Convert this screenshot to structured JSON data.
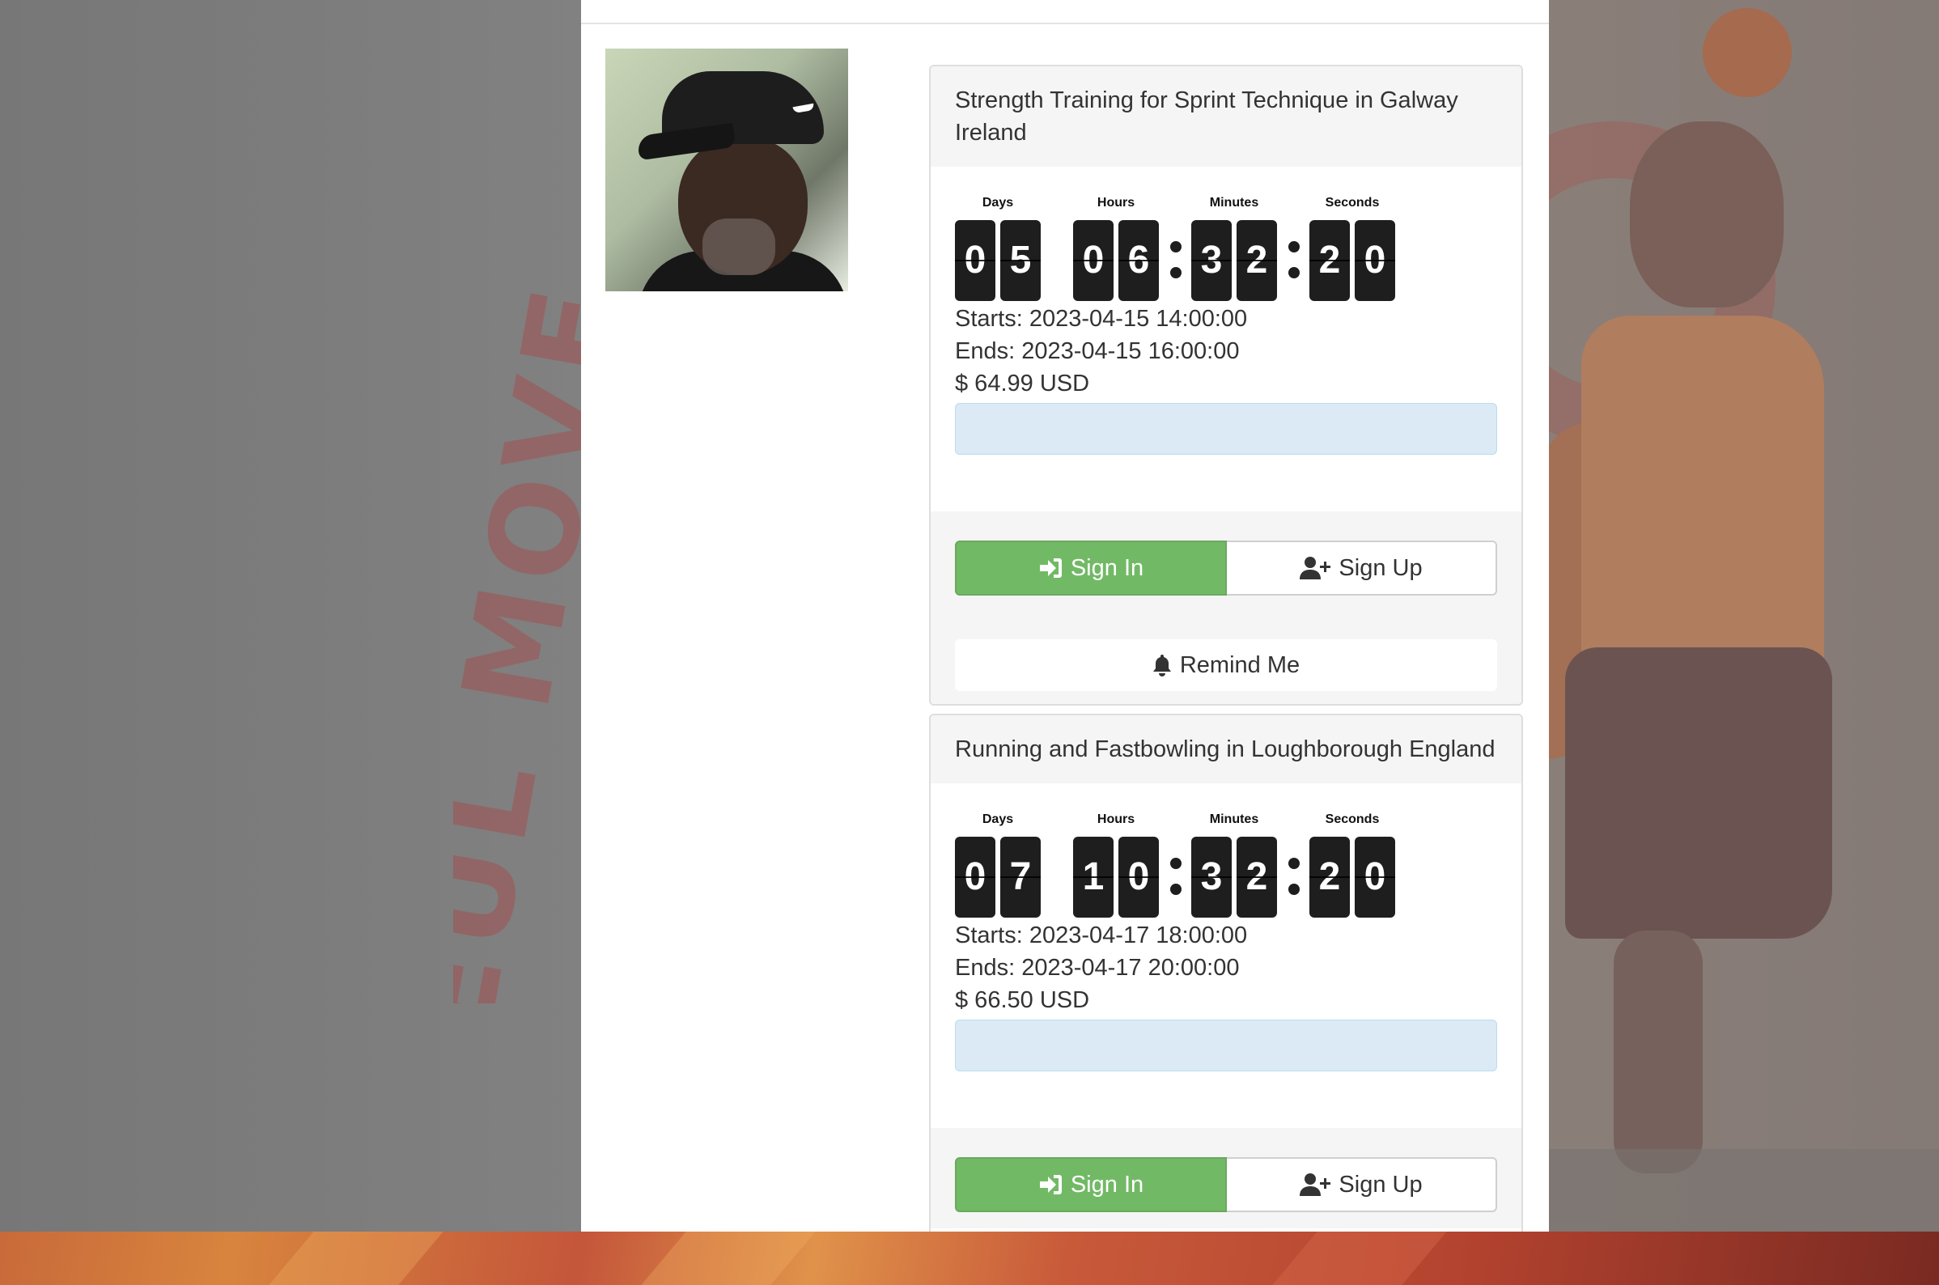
{
  "background": {
    "watermark_text": "EUL MOVE"
  },
  "coach": {
    "photo_alt": "Coach photo"
  },
  "countdown_labels": {
    "days": "Days",
    "hours": "Hours",
    "minutes": "Minutes",
    "seconds": "Seconds"
  },
  "events": [
    {
      "title": "Strength Training for Sprint Technique in Galway Ireland",
      "countdown": {
        "days": [
          "0",
          "5"
        ],
        "hours": [
          "0",
          "6"
        ],
        "minutes": [
          "3",
          "2"
        ],
        "seconds": [
          "2",
          "0"
        ]
      },
      "starts": "Starts: 2023-04-15 14:00:00",
      "ends": "Ends: 2023-04-15 16:00:00",
      "price": "$ 64.99 USD",
      "sign_in_label": "Sign In",
      "sign_up_label": "Sign Up",
      "remind_label": "Remind Me"
    },
    {
      "title": "Running and Fastbowling in Loughborough England",
      "countdown": {
        "days": [
          "0",
          "7"
        ],
        "hours": [
          "1",
          "0"
        ],
        "minutes": [
          "3",
          "2"
        ],
        "seconds": [
          "2",
          "0"
        ]
      },
      "starts": "Starts: 2023-04-17 18:00:00",
      "ends": "Ends: 2023-04-17 20:00:00",
      "price": "$ 66.50 USD",
      "sign_in_label": "Sign In",
      "sign_up_label": "Sign Up"
    }
  ],
  "colors": {
    "sign_in_green": "#72b966",
    "info_box_blue": "#dbeaf4",
    "digit_bg": "#1e1e1e"
  },
  "icons": {
    "sign_in": "sign-in-arrow-icon",
    "sign_up": "user-plus-icon",
    "remind": "bell-icon"
  }
}
